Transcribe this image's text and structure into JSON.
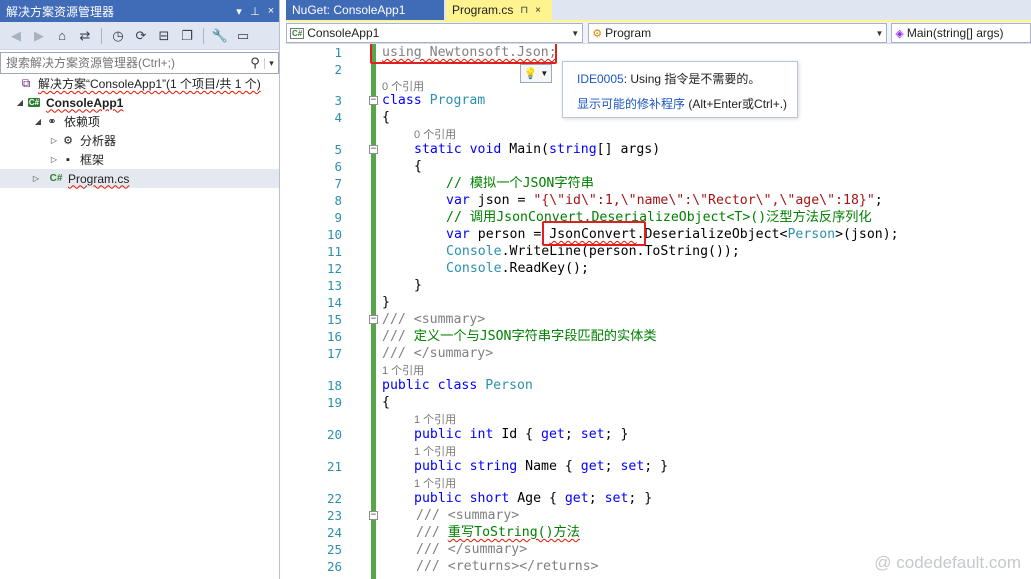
{
  "solution_explorer": {
    "title": "解决方案资源管理器",
    "title_buttons": [
      "▾",
      "⊥",
      "×"
    ],
    "search_placeholder": "搜索解决方案资源管理器(Ctrl+;)",
    "tree": {
      "solution": "解决方案“ConsoleApp1”(1 个项目/共 1 个)",
      "project": "ConsoleApp1",
      "dependencies": "依赖项",
      "analyzers": "分析器",
      "frameworks": "框架",
      "program_file": "Program.cs"
    },
    "icons": {
      "cs_badge": "C#"
    }
  },
  "tabs": [
    {
      "label": "NuGet: ConsoleApp1",
      "active": false
    },
    {
      "label": "Program.cs",
      "active": true,
      "pin": "⊓",
      "close": "×"
    }
  ],
  "nav": {
    "project": "ConsoleApp1",
    "type": "Program",
    "member": "Main(string[] args)"
  },
  "lens": {
    "zero_refs": "0 个引用",
    "one_ref": "1 个引用"
  },
  "code": {
    "l1": "using Newtonsoft.Json;",
    "l3_kw": "class",
    "l3_ty": "Program",
    "brace_open": "{",
    "brace_close": "}",
    "l5_a": "static void",
    "l5_b": "Main(",
    "l5_c": "string",
    "l5_d": "[] args)",
    "l7": "// 模拟一个JSON字符串",
    "l8_kw": "var",
    "l8_b": " json = ",
    "l8_str": "\"{\\\"id\\\":1,\\\"name\\\":\\\"Rector\\\",\\\"age\\\":18}\"",
    "l8_end": ";",
    "l9": "// 调用JsonConvert.DeserializeObject<T>()泛型方法反序列化",
    "l10_kw": "var",
    "l10_b": " person = ",
    "l10_c": "JsonConvert",
    "l10_d": ".DeserializeObject<",
    "l10_e": "Person",
    "l10_f": ">(json);",
    "l11_a": "Console",
    "l11_b": ".WriteLine(person.ToString());",
    "l12_a": "Console",
    "l12_b": ".ReadKey();",
    "l15_a": "/// ",
    "l15_b": "<summary>",
    "l16_a": "/// ",
    "l16_b": "定义一个与JSON字符串字段匹配的实体类",
    "l17_a": "/// ",
    "l17_b": "</summary>",
    "l18_kw": "public class",
    "l18_ty": "Person",
    "l20_kw": "public int",
    "l20_b": " Id { ",
    "l20_g": "get",
    "l20_c": "; ",
    "l20_s": "set",
    "l20_d": "; }",
    "l21_kw": "public string",
    "l21_b": " Name { ",
    "l22_kw": "public short",
    "l22_b": " Age { ",
    "l23_a": "/// ",
    "l23_b": "<summary>",
    "l24_a": "/// ",
    "l24_b": "重写ToString()方法",
    "l25_a": "/// ",
    "l25_b": "</summary>",
    "l26_a": "/// ",
    "l26_b": "<returns></returns>",
    "kw_get": "get",
    "kw_set": "set",
    "semi": "; ",
    "close_prop": "; }"
  },
  "line_numbers": [
    "1",
    "2",
    "3",
    "4",
    "5",
    "6",
    "7",
    "8",
    "9",
    "10",
    "11",
    "12",
    "13",
    "14",
    "15",
    "16",
    "17",
    "18",
    "19",
    "20",
    "21",
    "22",
    "23",
    "24",
    "25",
    "26"
  ],
  "tooltip": {
    "id": "IDE0005",
    "message": ": Using 指令是不需要的。",
    "link": "显示可能的修补程序",
    "shortcut": " (Alt+Enter或Ctrl+.)"
  },
  "lightbulb": "💡",
  "watermark": "@ codedefault.com",
  "colors": {
    "title_bar": "#3f6bb7",
    "active_tab": "#fef38f",
    "keyword": "#0000ff",
    "type": "#2b91af",
    "string": "#a31515",
    "comment": "#008000",
    "highlight_box": "#e02020"
  }
}
